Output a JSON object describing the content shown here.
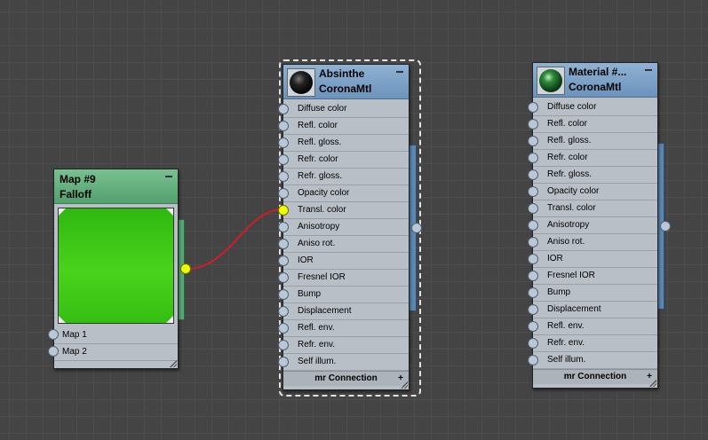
{
  "wire_color": "#d21c2a",
  "colors": {
    "blue_header": "#7fa3c8",
    "green_header": "#64b07f",
    "falloff_swatch": "#44cc1a",
    "socket_active": "#eeff00"
  },
  "nodes": {
    "map9": {
      "title": "Map #9",
      "subtitle": "Falloff",
      "slots": [
        "Map 1",
        "Map 2"
      ]
    },
    "absinthe": {
      "title": "Absinthe",
      "subtitle": "CoronaMtl",
      "icon": "material-sphere-dark",
      "slots": [
        "Diffuse color",
        "Refl. color",
        "Refl. gloss.",
        "Refr. color",
        "Refr. gloss.",
        "Opacity color",
        "Transl. color",
        "Anisotropy",
        "Aniso rot.",
        "IOR",
        "Fresnel IOR",
        "Bump",
        "Displacement",
        "Refl. env.",
        "Refr. env.",
        "Self illum."
      ],
      "footer": "mr Connection",
      "selected": true
    },
    "material": {
      "title": "Material #...",
      "subtitle": "CoronaMtl",
      "icon": "material-sphere-green",
      "slots": [
        "Diffuse color",
        "Refl. color",
        "Refl. gloss.",
        "Refr. color",
        "Refr. gloss.",
        "Opacity color",
        "Transl. color",
        "Anisotropy",
        "Aniso rot.",
        "IOR",
        "Fresnel IOR",
        "Bump",
        "Displacement",
        "Refl. env.",
        "Refr. env.",
        "Self illum."
      ],
      "footer": "mr Connection"
    }
  },
  "connection": {
    "from": "Map #9",
    "to": "Absinthe",
    "to_slot": "Transl. color"
  }
}
